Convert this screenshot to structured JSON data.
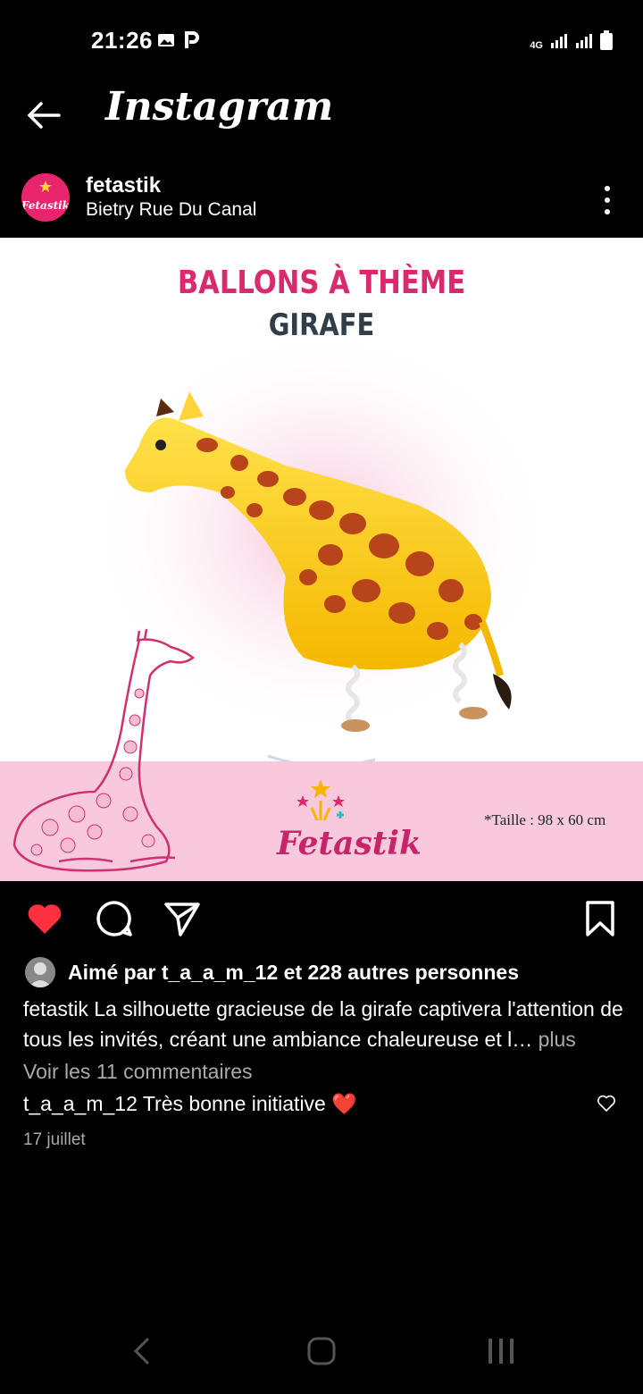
{
  "status": {
    "time": "21:26",
    "network": "4G"
  },
  "header": {
    "title": "Instagram"
  },
  "post": {
    "username": "fetastik",
    "location": "Bietry Rue Du Canal",
    "avatar_brand": "Fetastik",
    "image": {
      "title_line1": "BALLONS À THÈME",
      "title_line2": "GIRAFE",
      "brand": "Fetastik",
      "size_note": "*Taille : 98 x 60 cm"
    },
    "likes_text": "Aimé par t_a_a_m_12 et 228 autres personnes",
    "caption_user": "fetastik",
    "caption_text": " La silhouette gracieuse de la girafe captivera l'attention de tous les invités, créant une ambiance chaleureuse et l…",
    "caption_more": " plus",
    "view_comments": "Voir les 11 commentaires",
    "comment_user": "t_a_a_m_12",
    "comment_text": " Très bonne initiative ❤️",
    "date": "17 juillet"
  },
  "colors": {
    "like_red": "#ff3040",
    "brand_pink": "#d92a6d",
    "band_pink": "#f8c8dc"
  },
  "icons": [
    "back-arrow-icon",
    "more-vertical-icon",
    "heart-filled-icon",
    "comment-icon",
    "share-icon",
    "bookmark-icon",
    "heart-outline-icon"
  ]
}
